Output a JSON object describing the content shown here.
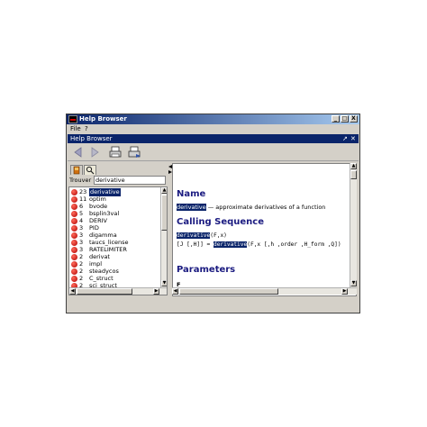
{
  "window": {
    "title": "Help Browser",
    "controls": [
      "_",
      "□",
      "X"
    ]
  },
  "menubar": [
    "File",
    "?"
  ],
  "inner_panel": {
    "title": "Help Browser",
    "controls": [
      "↗",
      "✕"
    ]
  },
  "search": {
    "label": "Trouver :",
    "value": "derivative"
  },
  "results": [
    {
      "count": "23",
      "name": "derivative",
      "selected": true
    },
    {
      "count": "11",
      "name": "optim"
    },
    {
      "count": "6",
      "name": "bvode"
    },
    {
      "count": "5",
      "name": "bsplin3val"
    },
    {
      "count": "4",
      "name": "DERIV"
    },
    {
      "count": "3",
      "name": "PID"
    },
    {
      "count": "3",
      "name": "digamma"
    },
    {
      "count": "3",
      "name": "taucs_license"
    },
    {
      "count": "3",
      "name": "RATELIMITER"
    },
    {
      "count": "2",
      "name": "derivat"
    },
    {
      "count": "2",
      "name": "impl"
    },
    {
      "count": "2",
      "name": "steadycos"
    },
    {
      "count": "2",
      "name": "C_struct"
    },
    {
      "count": "2",
      "name": "sci_struct"
    }
  ],
  "content": {
    "name_heading": "Name",
    "name_term": "derivative",
    "name_desc": " — approximate derivatives of a function",
    "calling_heading": "Calling Sequence",
    "call1_fn": "derivative",
    "call1_args": "(F,x)",
    "call2_pre": "[J [,H]] = ",
    "call2_fn": "derivative",
    "call2_args": "(F,x [,h ,order ,H_form ,Q])",
    "params_heading": "Parameters",
    "param_first": "F"
  },
  "colors": {
    "titlebar": "#0a246a",
    "heading": "#1a1a80",
    "result_dot": "#c00000"
  }
}
